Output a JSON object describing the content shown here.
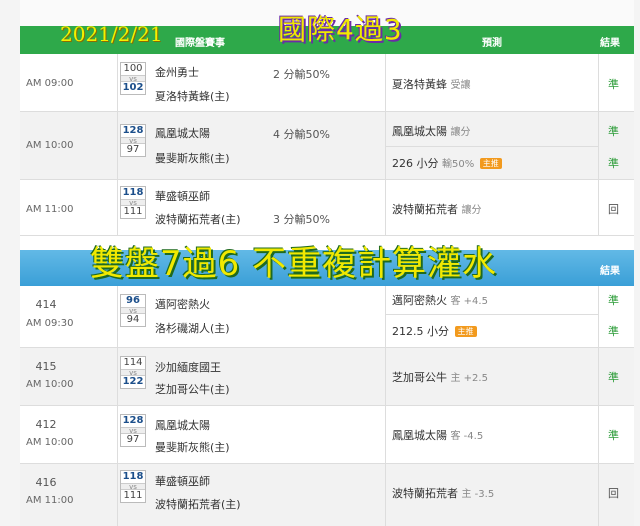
{
  "overlay": {
    "date": "2021/2/21",
    "title_top": "國際4過3",
    "title_mid": "雙盤7過6 不重複計算灌水"
  },
  "header1": {
    "match_label": "國際盤賽事",
    "pred_label": "預測",
    "result_label": "結果"
  },
  "header2": {
    "result_label": "結果"
  },
  "section1": [
    {
      "time": "AM 09:00",
      "score_away": "100",
      "score_home": "102",
      "away": "金州勇士",
      "home": "夏洛特黃蜂(主)",
      "odds": "2 分輸50%",
      "preds": [
        {
          "text": "夏洛特黃蜂",
          "sub": "受讓",
          "tag": ""
        }
      ],
      "result": "準"
    },
    {
      "time": "AM 10:00",
      "score_away": "128",
      "score_home": "97",
      "away": "鳳凰城太陽",
      "home": "曼斐斯灰熊(主)",
      "odds": "4 分輸50%",
      "preds": [
        {
          "text": "鳳凰城太陽",
          "sub": "讓分",
          "tag": ""
        },
        {
          "text": "226 小分",
          "sub": "輸50%",
          "tag": "主推"
        }
      ],
      "result": "準"
    },
    {
      "time": "AM 11:00",
      "score_away": "118",
      "score_home": "111",
      "away": "華盛頓巫師",
      "home": "波特蘭拓荒者(主)",
      "odds": "3 分輸50%",
      "preds": [
        {
          "text": "波特蘭拓荒者",
          "sub": "讓分",
          "tag": ""
        }
      ],
      "result": "回"
    }
  ],
  "section2": [
    {
      "num": "414",
      "time": "AM 09:30",
      "score_away": "96",
      "score_home": "94",
      "away": "邁阿密熱火",
      "home": "洛杉磯湖人(主)",
      "preds": [
        {
          "text": "邁阿密熱火",
          "sub": "客 +4.5",
          "tag": ""
        },
        {
          "text": "212.5 小分",
          "sub": "",
          "tag": "主推"
        }
      ],
      "results": [
        "準",
        "準"
      ]
    },
    {
      "num": "415",
      "time": "AM 10:00",
      "score_away": "114",
      "score_home": "122",
      "away": "沙加緬度國王",
      "home": "芝加哥公牛(主)",
      "preds": [
        {
          "text": "芝加哥公牛",
          "sub": "主 +2.5",
          "tag": ""
        }
      ],
      "results": [
        "準"
      ]
    },
    {
      "num": "412",
      "time": "AM 10:00",
      "score_away": "128",
      "score_home": "97",
      "away": "鳳凰城太陽",
      "home": "曼斐斯灰熊(主)",
      "preds": [
        {
          "text": "鳳凰城太陽",
          "sub": "客 -4.5",
          "tag": ""
        }
      ],
      "results": [
        "準"
      ]
    },
    {
      "num": "416",
      "time": "AM 11:00",
      "score_away": "118",
      "score_home": "111",
      "away": "華盛頓巫師",
      "home": "波特蘭拓荒者(主)",
      "preds": [
        {
          "text": "波特蘭拓荒者",
          "sub": "主 -3.5",
          "tag": ""
        }
      ],
      "results": [
        "回"
      ]
    }
  ],
  "colors": {
    "header_green": "#2ea94a",
    "header_blue": "#3a9fd7",
    "win_green": "#2e9d3a",
    "tag_orange": "#f29a1e",
    "overlay_yellow": "#f1e900"
  }
}
